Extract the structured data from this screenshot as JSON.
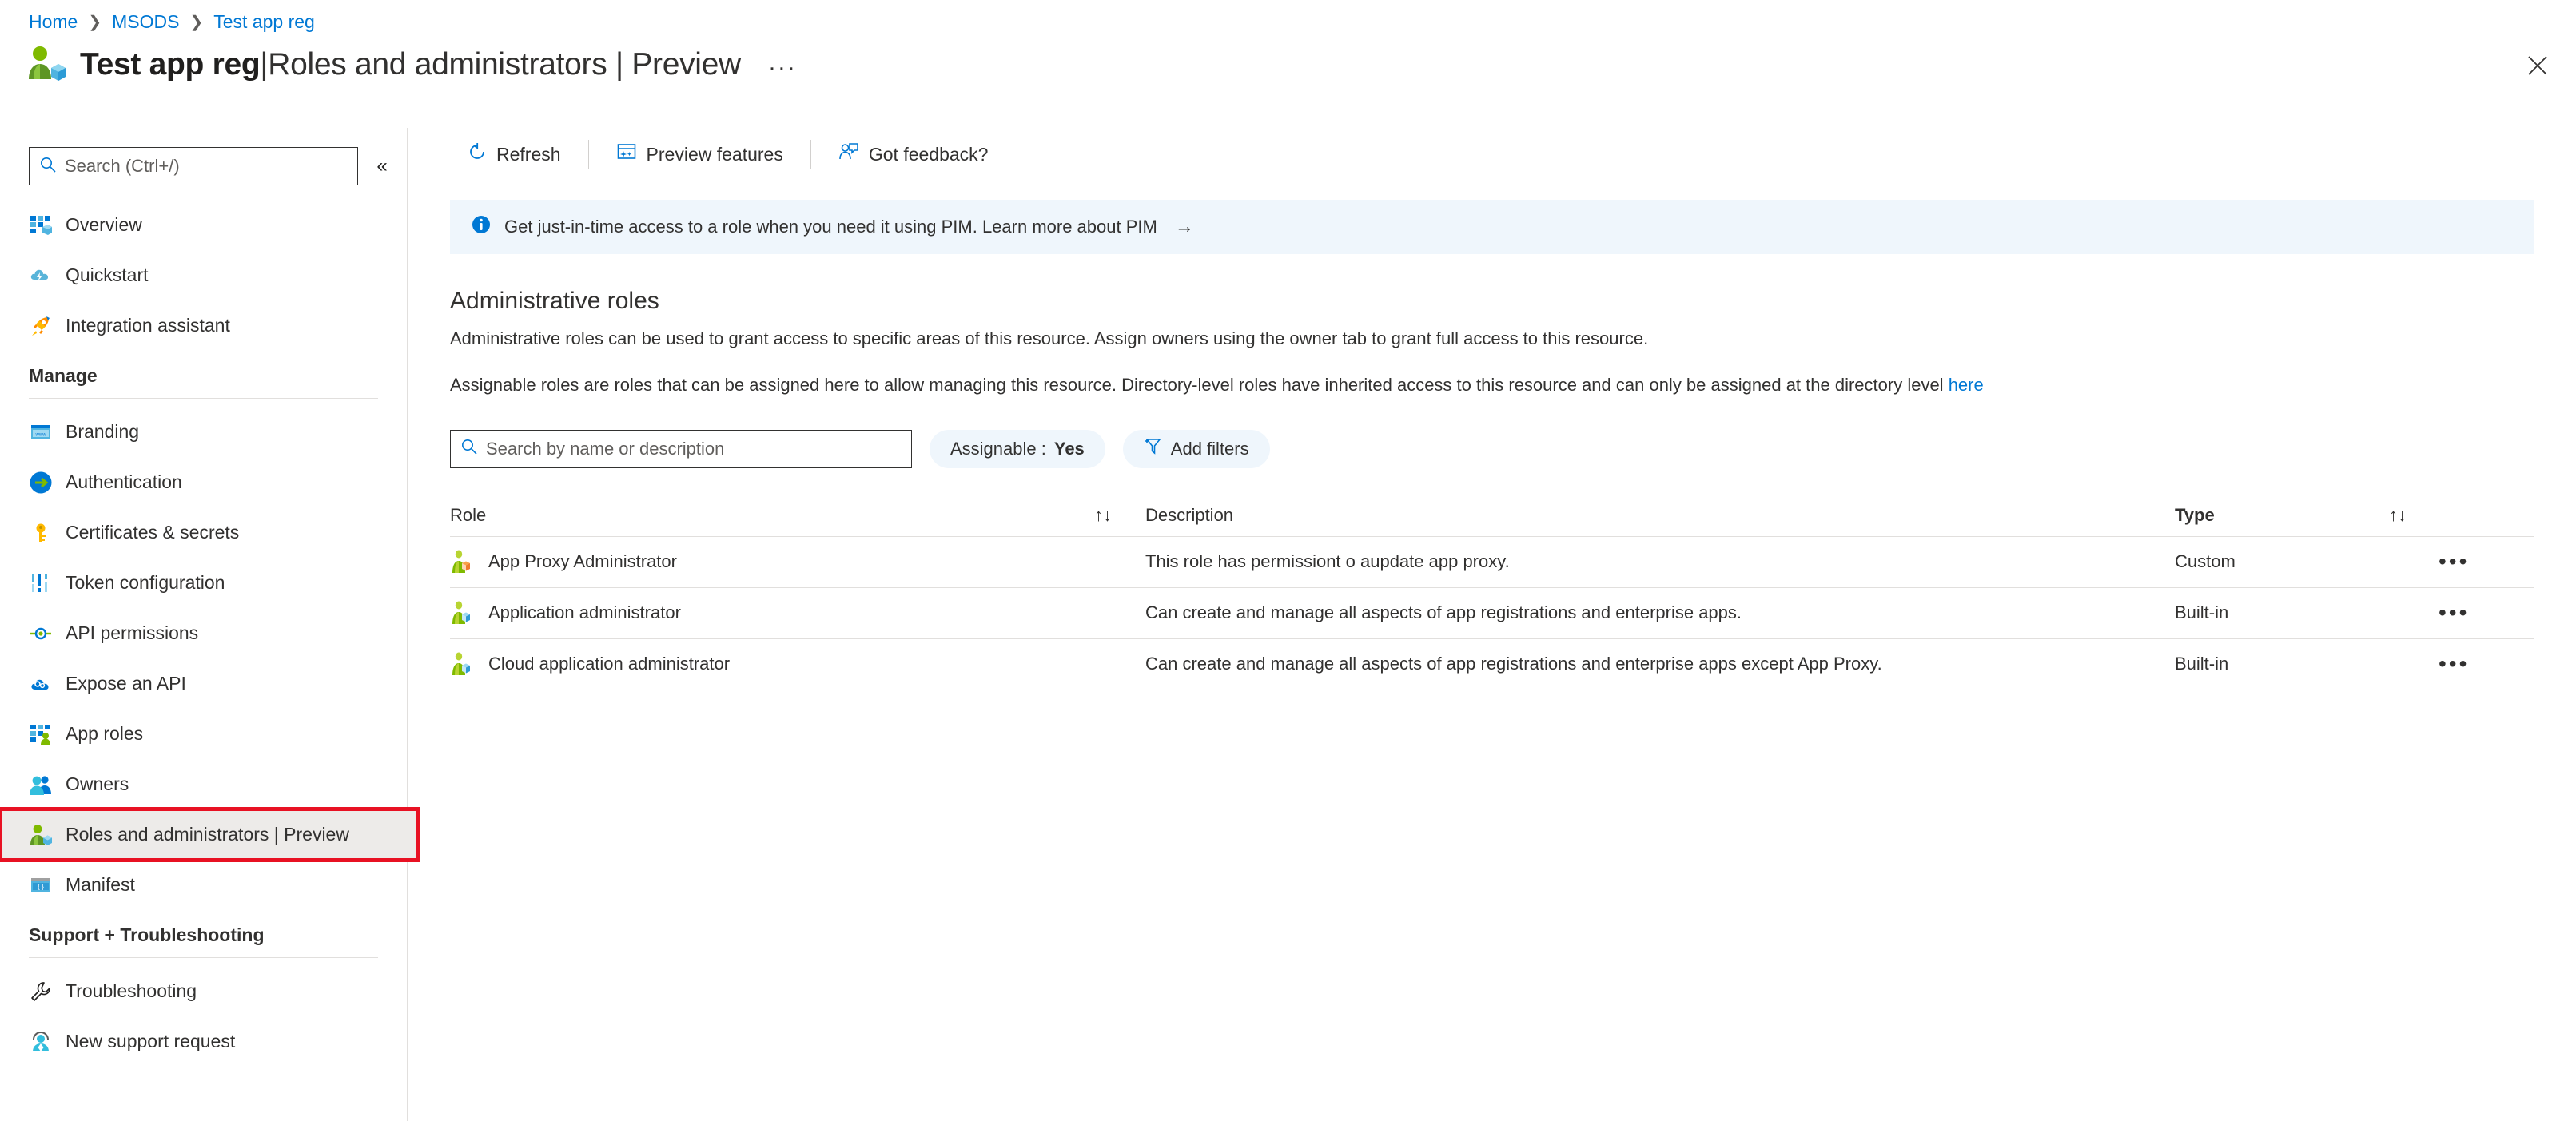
{
  "breadcrumb": [
    {
      "label": "Home"
    },
    {
      "label": "MSODS"
    },
    {
      "label": "Test app reg"
    }
  ],
  "header": {
    "resource_name": "Test app reg",
    "separator": "|",
    "section": "Roles and administrators | Preview",
    "ellipsis": "···",
    "close_label": "Close"
  },
  "sidebar": {
    "search_placeholder": "Search (Ctrl+/)",
    "collapse_label": "«",
    "items": [
      {
        "label": "Overview",
        "icon": "overview-icon"
      },
      {
        "label": "Quickstart",
        "icon": "quickstart-icon"
      },
      {
        "label": "Integration assistant",
        "icon": "rocket-icon"
      }
    ],
    "manage_group": "Manage",
    "manage_items": [
      {
        "label": "Branding",
        "icon": "branding-icon"
      },
      {
        "label": "Authentication",
        "icon": "authentication-icon"
      },
      {
        "label": "Certificates & secrets",
        "icon": "key-icon"
      },
      {
        "label": "Token configuration",
        "icon": "token-icon"
      },
      {
        "label": "API permissions",
        "icon": "api-permissions-icon"
      },
      {
        "label": "Expose an API",
        "icon": "expose-api-icon"
      },
      {
        "label": "App roles",
        "icon": "app-roles-icon"
      },
      {
        "label": "Owners",
        "icon": "owners-icon"
      },
      {
        "label": "Roles and administrators | Preview",
        "icon": "roles-icon",
        "selected": true
      },
      {
        "label": "Manifest",
        "icon": "manifest-icon"
      }
    ],
    "support_group": "Support + Troubleshooting",
    "support_items": [
      {
        "label": "Troubleshooting",
        "icon": "wrench-icon"
      },
      {
        "label": "New support request",
        "icon": "support-person-icon"
      }
    ]
  },
  "toolbar": {
    "refresh": "Refresh",
    "preview_features": "Preview features",
    "got_feedback": "Got feedback?"
  },
  "banner": {
    "text": "Get just-in-time access to a role when you need it using PIM. Learn more about PIM",
    "arrow": "→"
  },
  "section": {
    "title": "Administrative roles",
    "description": "Administrative roles can be used to grant access to specific areas of this resource. Assign owners using the owner tab to grant full access to this resource.",
    "description2_before": "Assignable roles are roles that can be assigned here to allow managing this resource. Directory-level roles have inherited access to this resource and can only be assigned at the directory level ",
    "description2_link": "here"
  },
  "filters": {
    "search_placeholder": "Search by name or description",
    "assignable_label": "Assignable : ",
    "assignable_value": "Yes",
    "add_filters": "Add filters"
  },
  "table": {
    "columns": {
      "role": "Role",
      "description": "Description",
      "type": "Type"
    },
    "sort_icon": "↑↓",
    "menu_icon": "•••",
    "rows": [
      {
        "role": "App Proxy Administrator",
        "description": "This role has permissiont o aupdate app proxy.",
        "type": "Custom"
      },
      {
        "role": "Application administrator",
        "description": "Can create and manage all aspects of app registrations and enterprise apps.",
        "type": "Built-in"
      },
      {
        "role": "Cloud application administrator",
        "description": "Can create and manage all aspects of app registrations and enterprise apps except App Proxy.",
        "type": "Built-in"
      }
    ]
  },
  "colors": {
    "accent": "#0078d4",
    "banner_bg": "#eff6fc",
    "selection_outline": "#e81123",
    "selection_bg": "#edebe9"
  }
}
